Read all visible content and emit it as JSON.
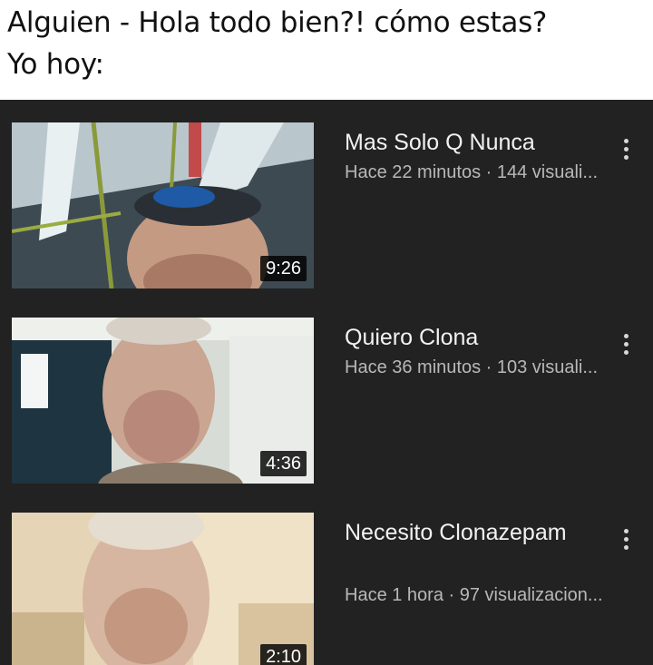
{
  "caption": {
    "line1": "Alguien - Hola todo bien?! cómo estas?",
    "line2": "Yo hoy:"
  },
  "videos": [
    {
      "title": "Mas Solo Q Nunca",
      "meta": "Hace 22 minutos · 144 visuali...",
      "duration": "9:26"
    },
    {
      "title": "Quiero Clona",
      "meta": "Hace 36 minutos · 103 visuali...",
      "duration": "4:36"
    },
    {
      "title": "Necesito Clonazepam",
      "meta": "Hace 1 hora · 97 visualizacion...",
      "duration": "2:10"
    }
  ],
  "icons": {
    "more": "more-vertical-icon"
  },
  "colors": {
    "page_background": "#ffffff",
    "panel_background": "#222222",
    "title_text": "#f2f2f2",
    "meta_text": "#b8b8b8"
  }
}
